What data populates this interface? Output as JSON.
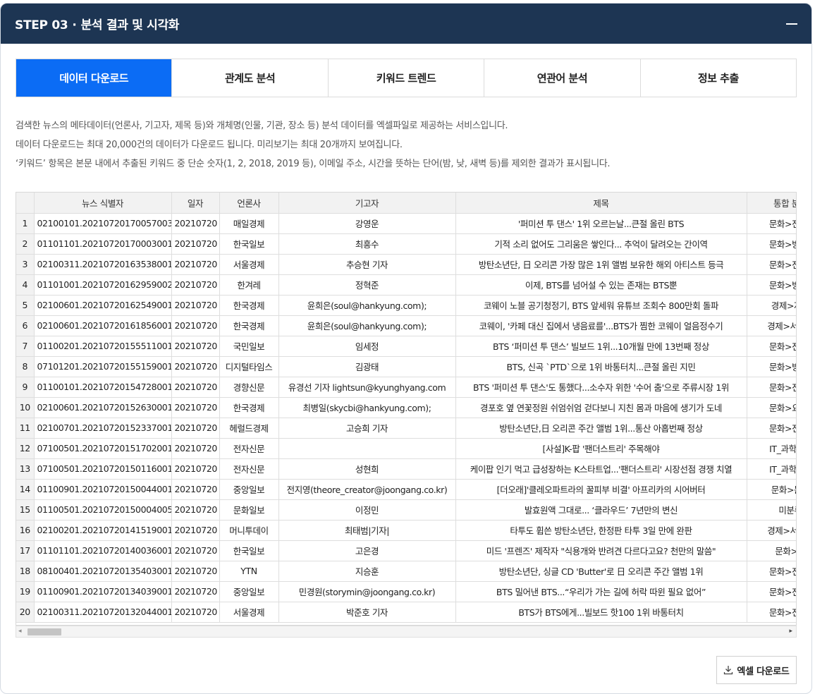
{
  "header": {
    "step": "STEP 03",
    "dot": "·",
    "title": "분석 결과 및 시각화"
  },
  "tabs": [
    {
      "label": "데이터 다운로드",
      "active": true
    },
    {
      "label": "관계도 분석",
      "active": false
    },
    {
      "label": "키워드 트렌드",
      "active": false
    },
    {
      "label": "연관어 분석",
      "active": false
    },
    {
      "label": "정보 추출",
      "active": false
    }
  ],
  "description": [
    "검색한 뉴스의 메타데이터(언론사, 기고자, 제목 등)와 개체명(인물, 기관, 장소 등) 분석 데이터를 엑셀파일로 제공하는 서비스입니다.",
    "데이터 다운로드는 최대 20,000건의 데이터가 다운로드 됩니다. 미리보기는 최대 20개까지 보여집니다.",
    "‘키워드’ 항목은 본문 내에서 추출된 키워드 중 단순 숫자(1, 2, 2018, 2019 등), 이메일 주소, 시간을 뜻하는 단어(밤, 낮, 새벽 등)를 제외한 결과가 표시됩니다."
  ],
  "table": {
    "columns": [
      "",
      "뉴스 식별자",
      "일자",
      "언론사",
      "기고자",
      "제목",
      "통합 분류"
    ],
    "rows": [
      [
        "1",
        "02100101.20210720170057003",
        "20210720",
        "매일경제",
        "강영운",
        "'퍼미션 투 댄스' 1위 오르는날...큰절 올린 BTS",
        "문화>전시_"
      ],
      [
        "2",
        "01101101.20210720170003001",
        "20210720",
        "한국일보",
        "최흥수",
        "기적 소리 없어도 그리움은 쌓인다... 추억이 달려오는 간이역",
        "문화>방송_"
      ],
      [
        "3",
        "02100311.20210720163538001",
        "20210720",
        "서울경제",
        "추승현 기자",
        "방탄소년단, 日 오리콘 가장 많은 1위 앨범 보유한 해외 아티스트 등극",
        "문화>전시_"
      ],
      [
        "4",
        "01101001.20210720162959002",
        "20210720",
        "한겨레",
        "정혁준",
        "이제, BTS를 넘어설 수 있는 존재는 BTS뿐",
        "문화>방송_"
      ],
      [
        "5",
        "02100601.20210720162549001",
        "20210720",
        "한국경제",
        "윤희은(soul@hankyung.com);",
        "코웨이 노블 공기청정기, BTS 앞세워 유튜브 조회수 800만회 돌파",
        "경제>자동"
      ],
      [
        "6",
        "02100601.20210720161856001",
        "20210720",
        "한국경제",
        "윤희은(soul@hankyung.com);",
        "코웨이, '카페 대신 집에서 냉음료를'...BTS가 찜한 코웨이 얼음정수기",
        "경제>서비스"
      ],
      [
        "7",
        "01100201.20210720155511001",
        "20210720",
        "국민일보",
        "임세정",
        "BTS ‘퍼미션 투 댄스’ 빌보드 1위...10개월 만에 13번째 정상",
        "문화>전시_"
      ],
      [
        "8",
        "07101201.20210720155159001",
        "20210720",
        "디지털타임스",
        "김광태",
        "BTS, 신곡 `PTD`으로 1위 바통터치...큰절 올린 지민",
        "문화>방송_"
      ],
      [
        "9",
        "01100101.20210720154728001",
        "20210720",
        "경향신문",
        "유경선 기자 lightsun@kyunghyang.com",
        "BTS '퍼미션 투 댄스'도 통했다...소수자 위한 '수어 춤'으로 주류시장 1위",
        "문화>전시_"
      ],
      [
        "10",
        "02100601.20210720152630001",
        "20210720",
        "한국경제",
        "최병일(skycbi@hankyung.com);",
        "경포호 옆 연꽃정원 쉬엄쉬엄 걷다보니 지친 몸과 마음에 생기가 도네",
        "문화>요리_"
      ],
      [
        "11",
        "02100701.20210720152337001",
        "20210720",
        "헤럴드경제",
        "고승희 기자",
        "방탄소년단,日 오리콘 주간 앨범 1위...통산 아홉번째 정상",
        "문화>전시_"
      ],
      [
        "12",
        "07100501.20210720151702001",
        "20210720",
        "전자신문",
        "",
        "[사설]K-팝 '팬더스트리' 주목해야",
        "IT_과학>콘"
      ],
      [
        "13",
        "07100501.20210720150116001",
        "20210720",
        "전자신문",
        "성현희",
        "케이팝 인기 먹고 급성장하는 K스타트업...'팬더스트리' 시장선점 경쟁 치열",
        "IT_과학>콘"
      ],
      [
        "14",
        "01100901.20210720150044001",
        "20210720",
        "중앙일보",
        "전지영(theore_creator@joongang.co.kr)",
        "[더오래]'클레오파트라의 꿀피부 비결' 아프리카의 시어버터",
        "문화>문화"
      ],
      [
        "15",
        "01100501.20210720150004005",
        "20210720",
        "문화일보",
        "이정민",
        "발효원액 그대로... ‘클라우드’ 7년만의 변신",
        "미분류"
      ],
      [
        "16",
        "02100201.20210720141519001",
        "20210720",
        "머니투데이",
        "최태범|기자|",
        "타투도 휩쓴 방탄소년단, 한정판 타투 3일 만에 완판",
        "경제>서비스"
      ],
      [
        "17",
        "01101101.20210720140036001",
        "20210720",
        "한국일보",
        "고은경",
        "미드 '프렌즈' 제작자 \"식용개와 반려견 다르다고요? 천만의 말씀\"",
        "문화>영"
      ],
      [
        "18",
        "08100401.20210720135403001",
        "20210720",
        "YTN",
        "지승훈",
        "방탄소년단, 싱글 CD 'Butter'로 日 오리콘 주간 앨범 1위",
        "문화>전시_"
      ],
      [
        "19",
        "01100901.20210720134039001",
        "20210720",
        "중앙일보",
        "민경원(storymin@joongang.co.kr)",
        "BTS 밀어낸 BTS...“우리가 가는 길에 허락 따윈 필요 없어”",
        "문화>전시_"
      ],
      [
        "20",
        "02100311.20210720132044001",
        "20210720",
        "서울경제",
        "박준호 기자",
        "BTS가 BTS에게...빌보드 핫100 1위 바통터치",
        "문화>전시_"
      ]
    ]
  },
  "scrollbar": {
    "left_arrow": "◂",
    "right_arrow": "▸"
  },
  "download_button": {
    "label": "엑셀 다운로드",
    "icon": "download-icon"
  }
}
